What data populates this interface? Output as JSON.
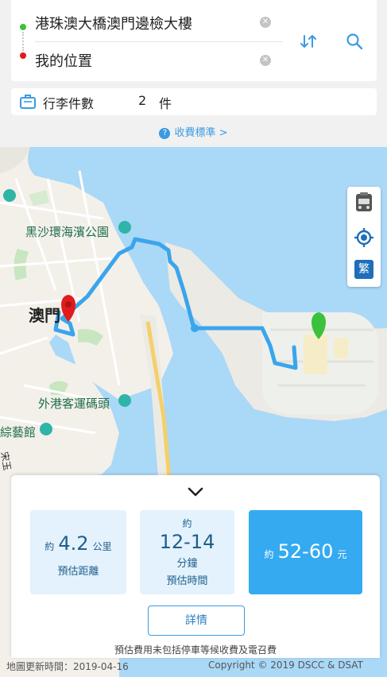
{
  "route": {
    "from": "港珠澳大橋澳門邊檢大樓",
    "to": "我的位置"
  },
  "luggage": {
    "label": "行李件數",
    "count": "2",
    "unit": "件"
  },
  "fee_link": "收費標準 >",
  "map": {
    "labels": {
      "park": "黑沙環海濱公園",
      "city": "澳門",
      "ferry": "外港客運碼頭",
      "museum": "綜藝館",
      "street": "宋玉"
    },
    "lang_button": "繁"
  },
  "estimate": {
    "distance": {
      "prefix": "約",
      "value": "4.2",
      "unit": "公里",
      "label": "預估距離"
    },
    "time": {
      "prefix": "約",
      "value": "12-14",
      "unit": "分鐘",
      "label": "預估時間"
    },
    "price": {
      "prefix": "約",
      "value": "52-60",
      "unit": "元"
    },
    "details_button": "詳情",
    "note": "預估費用未包括停車等候收費及電召費"
  },
  "footer": {
    "updated": "地圖更新時間：2019-04-16",
    "copyright": "Copyright © 2019 DSCC & DSAT"
  },
  "colors": {
    "accent": "#3a9be2",
    "route": "#3aa5ec",
    "price_box": "#35aaf0",
    "info_box": "#e3f2fc",
    "water": "#aad8f7",
    "start_marker": "#3bc13b",
    "end_marker": "#e01c1c"
  }
}
